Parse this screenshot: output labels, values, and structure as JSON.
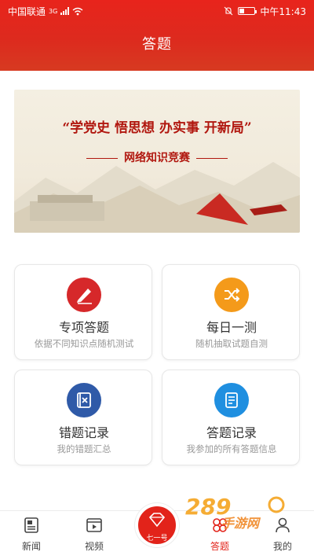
{
  "status_bar": {
    "carrier": "中国联通",
    "network": "3G",
    "time": "中午11:43"
  },
  "header": {
    "title": "答题"
  },
  "banner": {
    "slogan": "“学党史  悟思想  办实事  开新局”",
    "subtitle": "网络知识竞赛"
  },
  "cards": [
    {
      "name": "专项答题",
      "desc": "依据不同知识点随机测试",
      "icon": "pencil-icon",
      "color": "#d6282a"
    },
    {
      "name": "每日一测",
      "desc": "随机抽取试题自测",
      "icon": "shuffle-icon",
      "color": "#f49a1a"
    },
    {
      "name": "错题记录",
      "desc": "我的错题汇总",
      "icon": "wrong-book-icon",
      "color": "#2f5aa8"
    },
    {
      "name": "答题记录",
      "desc": "我参加的所有答题信息",
      "icon": "document-icon",
      "color": "#1f8fe0"
    }
  ],
  "nav": {
    "items": [
      {
        "label": "新闻",
        "icon": "news-icon"
      },
      {
        "label": "视频",
        "icon": "video-icon"
      },
      {
        "label": "答题",
        "icon": "quiz-icon",
        "active": true
      },
      {
        "label": "我的",
        "icon": "user-icon"
      }
    ],
    "center_label": "七一号"
  },
  "watermark": {
    "text": "手游网"
  },
  "colors": {
    "primary": "#e2231a"
  }
}
